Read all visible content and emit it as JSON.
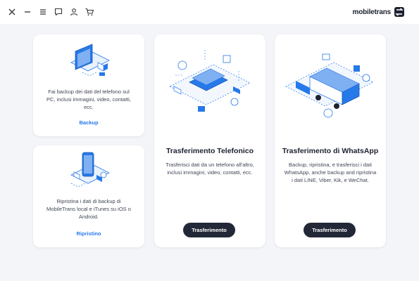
{
  "brand": {
    "name": "mobiletrans",
    "accent": "#2679e8"
  },
  "window": {
    "icons": [
      "close-icon",
      "minimize-icon",
      "menu-icon",
      "feedback-icon",
      "account-icon",
      "cart-icon"
    ]
  },
  "cards": {
    "backup": {
      "description": "Fai backup dei dati del telefono sul PC, inclusi immagini, video, contatti, ecc.",
      "link": "Backup"
    },
    "restore": {
      "description": "Ripristina i dati di backup di MobileTrans local e iTunes su iOS o Android.",
      "link": "Ripristino"
    },
    "phone_transfer": {
      "title": "Trasferimento Telefonico",
      "description": "Trasferisci dati da un telefono all'altro, inclusi immagini, video, contatti, ecc.",
      "button": "Trasferimento"
    },
    "whatsapp_transfer": {
      "title": "Trasferimento di WhatsApp",
      "description": "Backup, ripristina, e trasferisci i dati WhatsApp, anche backup and ripristina i dati LINE, Viber, Kik, e WeChat.",
      "button": "Trasferimento"
    }
  },
  "colors": {
    "button_bg": "#232838",
    "illustration_blue": "#2679e8",
    "background": "#f4f5f8"
  }
}
